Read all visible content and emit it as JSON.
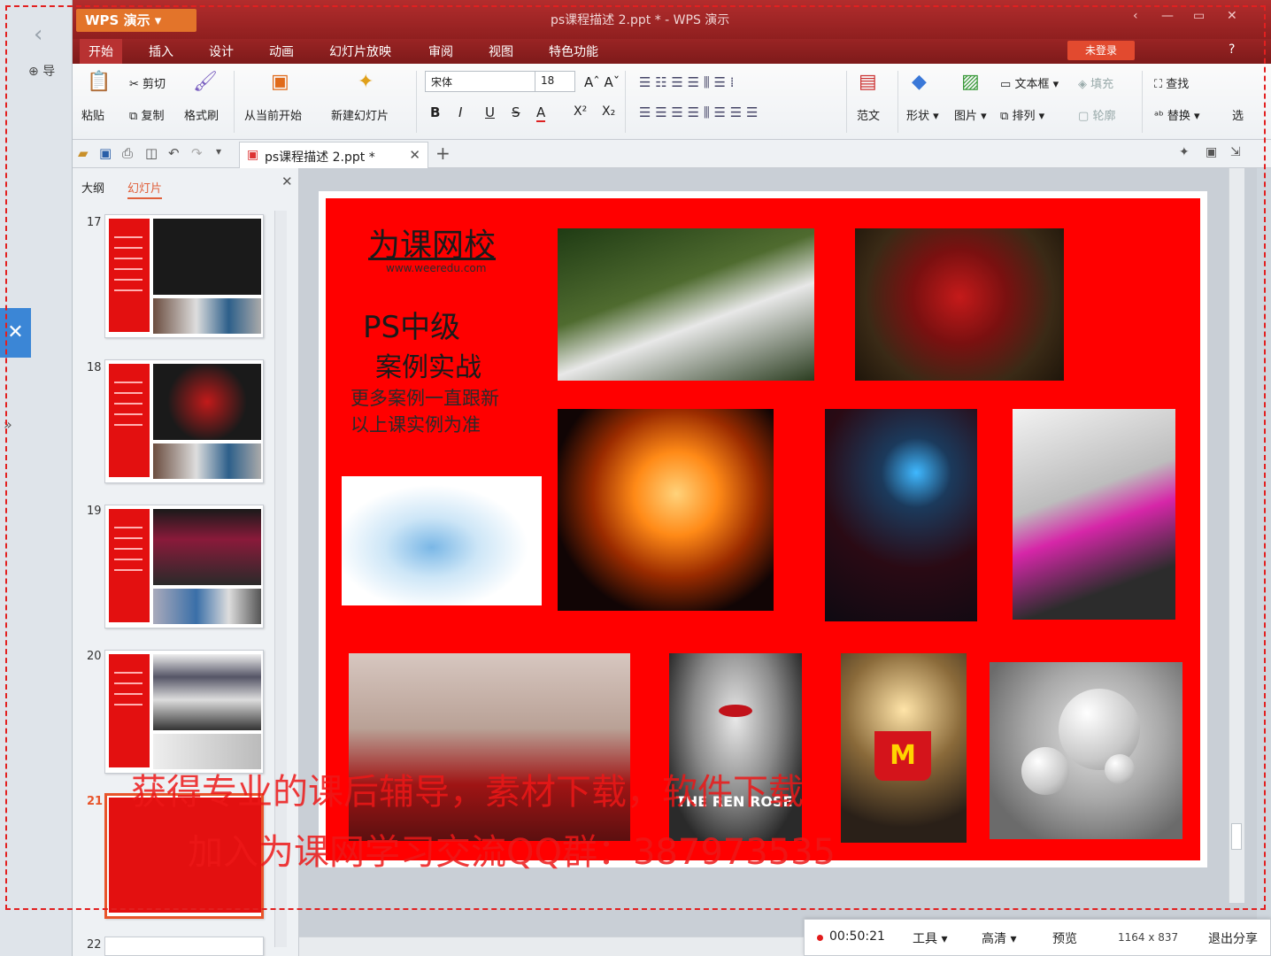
{
  "window": {
    "app_button": "WPS 演示",
    "title": "ps课程描述 2.ppt * - WPS 演示",
    "controls": [
      "‹",
      "—",
      "▭",
      "✕"
    ]
  },
  "left_strip": {
    "import_label": "导"
  },
  "menu": {
    "items": [
      "开始",
      "插入",
      "设计",
      "动画",
      "幻灯片放映",
      "审阅",
      "视图",
      "特色功能"
    ],
    "login": "未登录",
    "help": "?"
  },
  "ribbon": {
    "paste": "粘贴",
    "cut": "剪切",
    "copy": "复制",
    "format_painter": "格式刷",
    "from_current": "从当前开始",
    "new_slide": "新建幻灯片",
    "font_name": "宋体",
    "font_size": "18",
    "bold": "B",
    "italic": "I",
    "underline": "U",
    "strike": "S",
    "font_color": "A",
    "superscript": "X²",
    "subscript": "X₂",
    "template": "范文",
    "shape": "形状",
    "picture": "图片",
    "textbox": "文本框",
    "arrange": "排列",
    "fill": "填充",
    "outline": "轮廓",
    "find": "查找",
    "replace": "替换",
    "select": "选"
  },
  "tab": {
    "doc_name": "ps课程描述 2.ppt *",
    "close": "✕",
    "add": "+"
  },
  "panel": {
    "tab_outline": "大纲",
    "tab_slides": "幻灯片",
    "close": "✕",
    "slides": [
      "17",
      "18",
      "19",
      "20",
      "21",
      "22"
    ]
  },
  "slide": {
    "brand": "为课网校",
    "url": "www.weeredu.com",
    "course_title": "PS中级",
    "course_sub": "案例实战",
    "note1": "更多案例一直跟新",
    "note2": "以上课实例为准",
    "poster_caption": "THE REN ROSE"
  },
  "watermark": {
    "line1": "获得专业的课后辅导，素材下载，软件下载",
    "line2": "加入为课网学习交流QQ群：387973535"
  },
  "recorder": {
    "time": "00:50:21",
    "tools": "工具",
    "quality": "高清",
    "preview": "预览",
    "resolution": "1164 x 837",
    "exit_share": "退出分享"
  },
  "colors": {
    "slide_bg": "#ff0000",
    "title_bar": "#a02828",
    "accent": "#e3742a"
  }
}
